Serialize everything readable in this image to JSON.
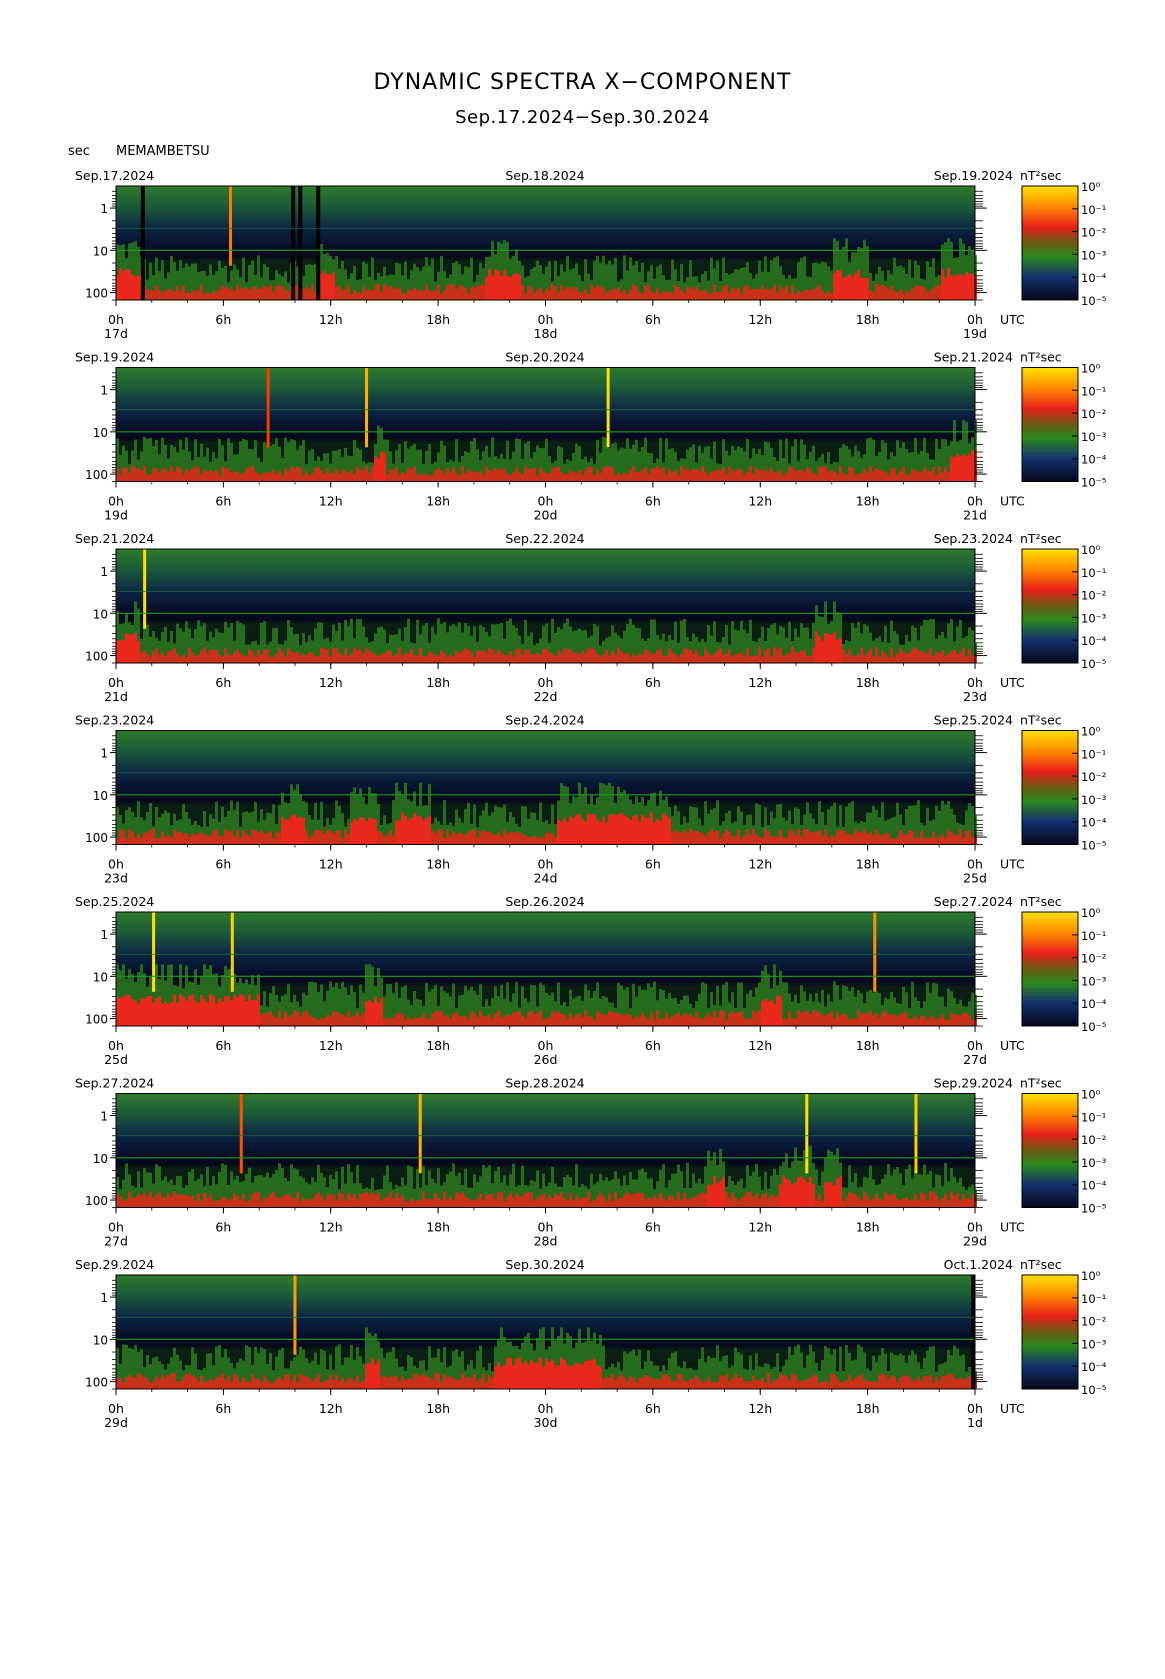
{
  "title": "DYNAMIC SPECTRA X−COMPONENT",
  "subtitle": "Sep.17.2024−Sep.30.2024",
  "y_unit": "sec",
  "station": "MEMAMBETSU",
  "chart_data": {
    "type": "heatmap",
    "x_tick_labels": [
      "0h",
      "6h",
      "12h",
      "18h",
      "0h",
      "6h",
      "12h",
      "18h",
      "0h"
    ],
    "x_unit": "UTC",
    "y_axis": {
      "label": "sec",
      "scale": "log",
      "ticks": [
        "1",
        "10",
        "100"
      ],
      "range": [
        0.3,
        150
      ]
    },
    "colorbar": {
      "unit": "nT²sec",
      "scale": "log",
      "ticks": [
        "10⁰",
        "10⁻¹",
        "10⁻²",
        "10⁻³",
        "10⁻⁴",
        "10⁻⁵"
      ],
      "colors": [
        "#ffe100",
        "#ff8a00",
        "#e8201a",
        "#2a8a1c",
        "#143070",
        "#050818"
      ]
    },
    "panels": [
      {
        "left_date": "Sep.17.2024",
        "mid_date": "Sep.18.2024",
        "right_date": "Sep.19.2024",
        "day_labels": [
          "17d",
          "18d",
          "19d"
        ],
        "spikes": [
          {
            "hour": 6.4,
            "color": "#ff7a00"
          }
        ],
        "gaps": [
          1.5,
          9.9,
          10.3,
          11.3
        ],
        "busy": [
          [
            0,
            1.5
          ],
          [
            11.2,
            12.2
          ],
          [
            20.5,
            22.5
          ],
          [
            40,
            42
          ],
          [
            46,
            48
          ]
        ]
      },
      {
        "left_date": "Sep.19.2024",
        "mid_date": "Sep.20.2024",
        "right_date": "Sep.21.2024",
        "day_labels": [
          "19d",
          "20d",
          "21d"
        ],
        "spikes": [
          {
            "hour": 8.5,
            "color": "#ff3a00"
          },
          {
            "hour": 14.0,
            "color": "#ffb000"
          },
          {
            "hour": 27.5,
            "color": "#ffe000"
          }
        ],
        "gaps": [],
        "busy": [
          [
            14.3,
            15.0
          ],
          [
            46.5,
            48
          ]
        ]
      },
      {
        "left_date": "Sep.21.2024",
        "mid_date": "Sep.22.2024",
        "right_date": "Sep.23.2024",
        "day_labels": [
          "21d",
          "22d",
          "23d"
        ],
        "spikes": [
          {
            "hour": 1.6,
            "color": "#ffe000"
          }
        ],
        "gaps": [],
        "busy": [
          [
            0,
            1.2
          ],
          [
            39,
            40.5
          ]
        ]
      },
      {
        "left_date": "Sep.23.2024",
        "mid_date": "Sep.24.2024",
        "right_date": "Sep.25.2024",
        "day_labels": [
          "23d",
          "24d",
          "25d"
        ],
        "spikes": [],
        "gaps": [],
        "busy": [
          [
            9.2,
            10.5
          ],
          [
            13,
            14.5
          ],
          [
            15.5,
            17.5
          ],
          [
            24.5,
            31
          ]
        ]
      },
      {
        "left_date": "Sep.25.2024",
        "mid_date": "Sep.26.2024",
        "right_date": "Sep.27.2024",
        "day_labels": [
          "25d",
          "26d",
          "27d"
        ],
        "spikes": [
          {
            "hour": 2.1,
            "color": "#ffe000"
          },
          {
            "hour": 6.5,
            "color": "#ffd000"
          },
          {
            "hour": 42.4,
            "color": "#ff9000"
          }
        ],
        "gaps": [],
        "busy": [
          [
            0,
            8
          ],
          [
            13.8,
            14.8
          ],
          [
            36,
            37.2
          ]
        ]
      },
      {
        "left_date": "Sep.27.2024",
        "mid_date": "Sep.28.2024",
        "right_date": "Sep.29.2024",
        "day_labels": [
          "27d",
          "28d",
          "29d"
        ],
        "spikes": [
          {
            "hour": 7.0,
            "color": "#ff5000"
          },
          {
            "hour": 17.0,
            "color": "#ffb000"
          },
          {
            "hour": 38.6,
            "color": "#ffe000"
          },
          {
            "hour": 44.7,
            "color": "#ffd000"
          }
        ],
        "gaps": [],
        "busy": [
          [
            33,
            34
          ],
          [
            37,
            39
          ],
          [
            39.5,
            40.5
          ]
        ]
      },
      {
        "left_date": "Sep.29.2024",
        "mid_date": "Sep.30.2024",
        "right_date": "Oct.1.2024",
        "day_labels": [
          "29d",
          "30d",
          "1d"
        ],
        "spikes": [
          {
            "hour": 10.0,
            "color": "#ff9a00"
          }
        ],
        "gaps": [
          47.9
        ],
        "busy": [
          [
            13.8,
            14.6
          ],
          [
            21,
            27
          ]
        ]
      }
    ]
  }
}
